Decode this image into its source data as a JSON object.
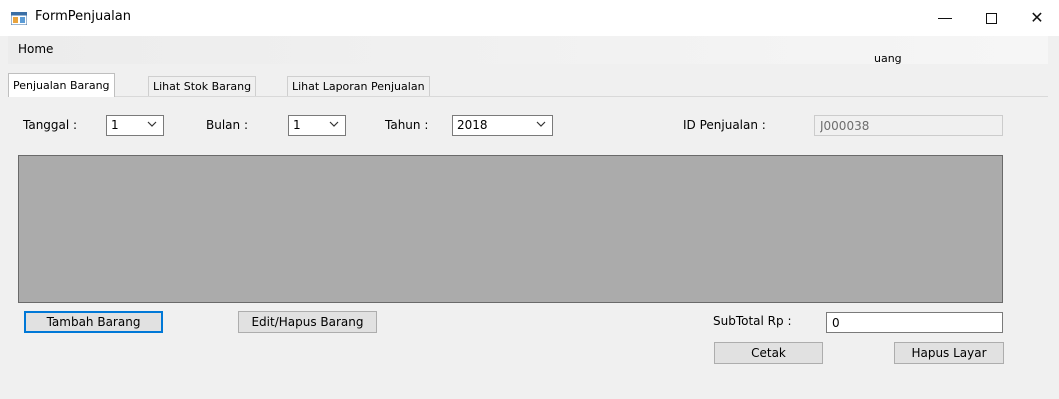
{
  "window": {
    "title": "FormPenjualan",
    "icon": "form-app-icon",
    "controls": {
      "minimize": "—",
      "maximize": "☐",
      "close": "✕"
    }
  },
  "menu": {
    "home_label": "Home",
    "user_label": "uang"
  },
  "tabs": [
    {
      "label": "Penjualan Barang",
      "active": true
    },
    {
      "label": "Lihat Stok Barang",
      "active": false
    },
    {
      "label": "Lihat Laporan Penjualan",
      "active": false
    }
  ],
  "form": {
    "tanggal_label": "Tanggal :",
    "tanggal_value": "1",
    "bulan_label": "Bulan :",
    "bulan_value": "1",
    "tahun_label": "Tahun :",
    "tahun_value": "2018",
    "id_label": "ID Penjualan :",
    "id_value": "J000038"
  },
  "buttons": {
    "tambah": "Tambah Barang",
    "edit_hapus": "Edit/Hapus Barang",
    "cetak": "Cetak",
    "hapus_layar": "Hapus Layar"
  },
  "subtotal": {
    "label": "SubTotal Rp :",
    "value": "0"
  },
  "colors": {
    "grid_background": "#ababab",
    "focus_border": "#0078d7",
    "button_face": "#e1e1e1"
  }
}
